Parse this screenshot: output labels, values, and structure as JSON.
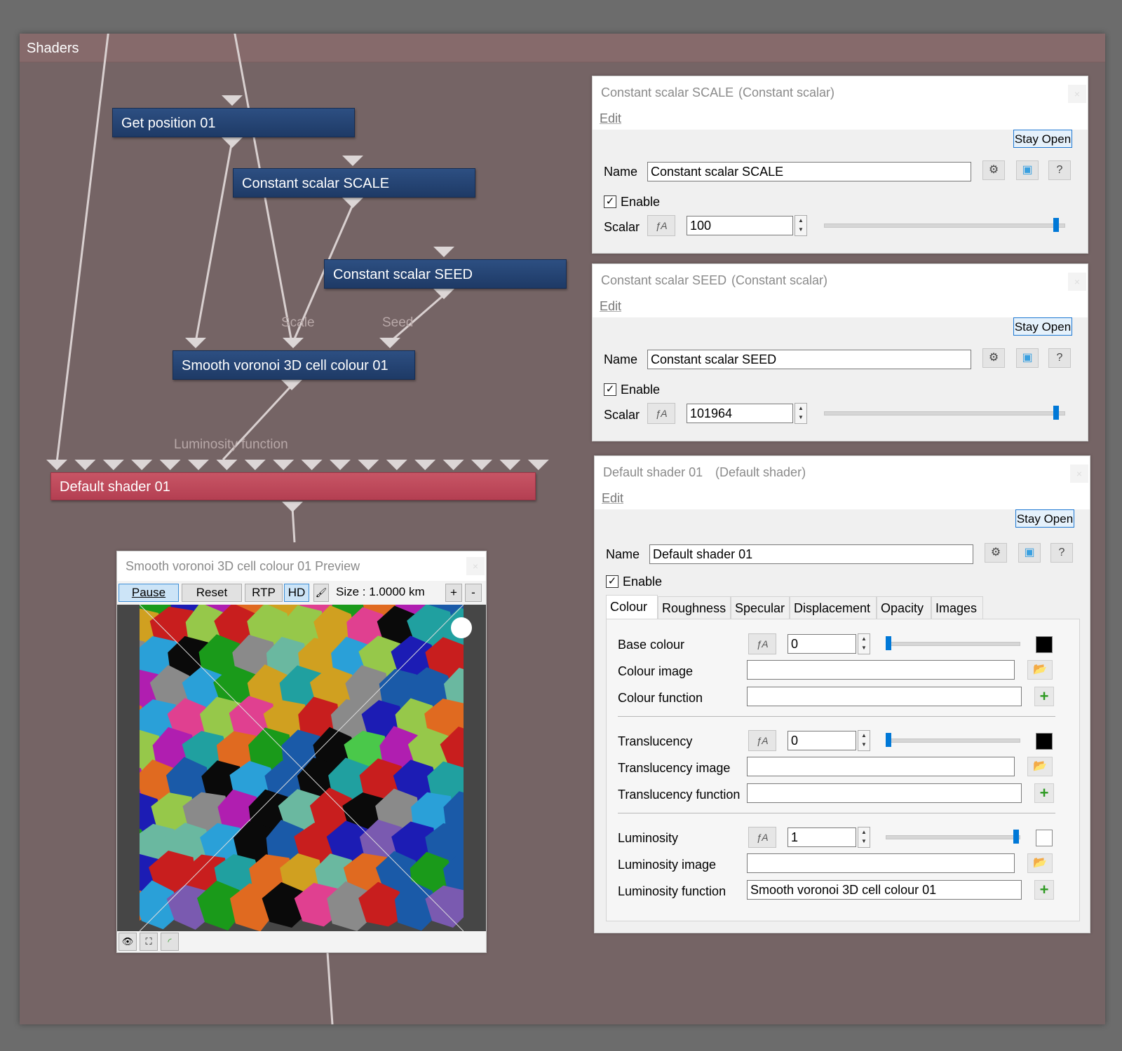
{
  "group": {
    "title": "Shaders"
  },
  "nodes": {
    "get_position": "Get position 01",
    "scale": "Constant scalar SCALE",
    "seed": "Constant scalar SEED",
    "voronoi": "Smooth voronoi 3D cell colour 01",
    "default_shader": "Default shader 01"
  },
  "wire_labels": {
    "scale": "Scale",
    "seed": "Seed",
    "luminosity_function": "Luminosity function"
  },
  "panels": {
    "scale": {
      "title": "Constant scalar SCALE",
      "type": "(Constant scalar)",
      "menu": "Edit",
      "stay_open": "Stay Open",
      "name_label": "Name",
      "name_value": "Constant scalar SCALE",
      "enable_label": "Enable",
      "enabled": true,
      "scalar_label": "Scalar",
      "scalar_value": "100",
      "slider_fraction": 0.98
    },
    "seed": {
      "title": "Constant scalar SEED",
      "type": "(Constant scalar)",
      "menu": "Edit",
      "stay_open": "Stay Open",
      "name_label": "Name",
      "name_value": "Constant scalar SEED",
      "enable_label": "Enable",
      "enabled": true,
      "scalar_label": "Scalar",
      "scalar_value": "101964",
      "slider_fraction": 0.98
    },
    "shader": {
      "title": "Default shader 01",
      "type": "(Default shader)",
      "menu": "Edit",
      "stay_open": "Stay Open",
      "name_label": "Name",
      "name_value": "Default shader 01",
      "enable_label": "Enable",
      "enabled": true,
      "tabs": [
        "Colour",
        "Roughness",
        "Specular",
        "Displacement",
        "Opacity",
        "Images"
      ],
      "active_tab": "Colour",
      "rows": {
        "base_colour": {
          "label": "Base colour",
          "value": "0",
          "swatch": "#000000",
          "slider_fraction": 0.0
        },
        "colour_image": {
          "label": "Colour image",
          "value": ""
        },
        "colour_function": {
          "label": "Colour function",
          "value": ""
        },
        "translucency": {
          "label": "Translucency",
          "value": "0",
          "swatch": "#000000",
          "slider_fraction": 0.0
        },
        "translucency_image": {
          "label": "Translucency image",
          "value": ""
        },
        "translucency_function": {
          "label": "Translucency function",
          "value": ""
        },
        "luminosity": {
          "label": "Luminosity",
          "value": "1",
          "swatch": "#ffffff",
          "slider_fraction": 1.0
        },
        "luminosity_image": {
          "label": "Luminosity image",
          "value": ""
        },
        "luminosity_function": {
          "label": "Luminosity function",
          "value": "Smooth voronoi 3D cell colour 01"
        }
      }
    }
  },
  "preview": {
    "title": "Smooth voronoi 3D cell colour 01 Preview",
    "buttons": {
      "pause": "Pause",
      "reset": "Reset",
      "rtp": "RTP",
      "hd": "HD"
    },
    "size_text": "Size : 1.0000 km",
    "zoom_in": "+",
    "zoom_out": "-"
  },
  "icons": {
    "gear": "⚙",
    "help": "?",
    "checkmark": "✓",
    "folder": "📂",
    "plus": "+",
    "close": "×",
    "spin_up": "▲",
    "spin_down": "▼",
    "function": "ƒA",
    "eye": "👁",
    "fit": "⛶",
    "brush": "🖌"
  }
}
